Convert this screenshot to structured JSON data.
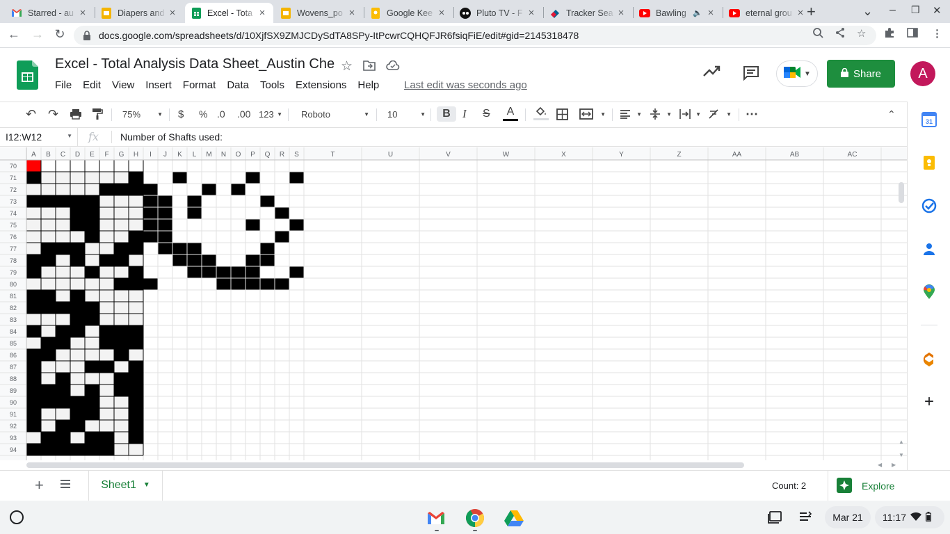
{
  "browser": {
    "tabs": [
      {
        "title": "Starred - au",
        "icon": "gmail-icon"
      },
      {
        "title": "Diapers and",
        "icon": "slides-icon"
      },
      {
        "title": "Excel - Tota",
        "icon": "sheets-icon",
        "active": true
      },
      {
        "title": "Wovens_po",
        "icon": "slides-icon"
      },
      {
        "title": "Google Kee",
        "icon": "keep-icon"
      },
      {
        "title": "Pluto TV - F",
        "icon": "pluto-icon"
      },
      {
        "title": "Tracker Sea",
        "icon": "tracker-icon"
      },
      {
        "title": "Bawling",
        "icon": "youtube-icon",
        "audio": true
      },
      {
        "title": "eternal grou",
        "icon": "youtube-icon"
      }
    ],
    "url": "docs.google.com/spreadsheets/d/10XjfSX9ZMJCDySdTA8SPy-ItPcwrCQHQFJR6fsiqFiE/edit#gid=2145318478"
  },
  "doc": {
    "title": "Excel - Total Analysis Data Sheet_Austin Che",
    "menus": [
      "File",
      "Edit",
      "View",
      "Insert",
      "Format",
      "Data",
      "Tools",
      "Extensions",
      "Help"
    ],
    "last_edit": "Last edit was seconds ago",
    "share_label": "Share",
    "avatar_letter": "A"
  },
  "toolbar": {
    "zoom": "75%",
    "currency": "$",
    "percent": "%",
    "dec_decrease": ".0",
    "dec_increase": ".00",
    "format_more": "123",
    "font": "Roboto",
    "font_size": "10"
  },
  "formula_bar": {
    "name_box": "I12:W12",
    "fx": "fx",
    "content": "Number of Shafts used:"
  },
  "grid": {
    "columns": [
      "A",
      "B",
      "C",
      "D",
      "E",
      "F",
      "G",
      "H",
      "I",
      "J",
      "K",
      "L",
      "M",
      "N",
      "O",
      "P",
      "Q",
      "R",
      "S",
      "T",
      "U",
      "V",
      "W",
      "X",
      "Y",
      "Z",
      "AA",
      "AB",
      "AC"
    ],
    "first_row": 70,
    "rows": [
      70,
      71,
      72,
      73,
      74,
      75,
      76,
      77,
      78,
      79,
      80,
      81,
      82,
      83,
      84,
      85,
      86,
      87,
      88,
      89,
      90,
      91,
      92,
      93,
      94
    ],
    "left_pattern": [
      "........",
      "#......#",
      ".....###",
      "#####...",
      "...##...",
      "...##...",
      "....#..#",
      ".###..##",
      "##.#.##.",
      "#...#..#",
      "......##",
      "##.#....",
      "#####...",
      "...##...",
      "#.##.###",
      ".##..###",
      "##....#.",
      "#...##.#",
      "#.#...##",
      "###.#.##",
      "#####..#",
      "#..##..#",
      "#.##...#",
      ".##.##.#",
      "######.."
    ],
    "right_pattern": [
      "...........",
      "..#....#..#",
      "#...#.#....",
      "##.#....#..",
      "##.#.....#.",
      "##.....#..#",
      "##.......#.",
      ".###....#..",
      "..###..##..",
      "...#####..#",
      "#....#####."
    ],
    "red_cell": "A70"
  },
  "sheet": {
    "tab_label": "Sheet1",
    "count": "Count: 2",
    "explore_label": "Explore"
  },
  "shelf": {
    "date": "Mar 21",
    "time": "11:17"
  },
  "colors": {
    "share_green": "#1e8e3e",
    "sheet_green": "#188038",
    "red_cell": "#ff0000",
    "avatar": "#c2185b"
  }
}
